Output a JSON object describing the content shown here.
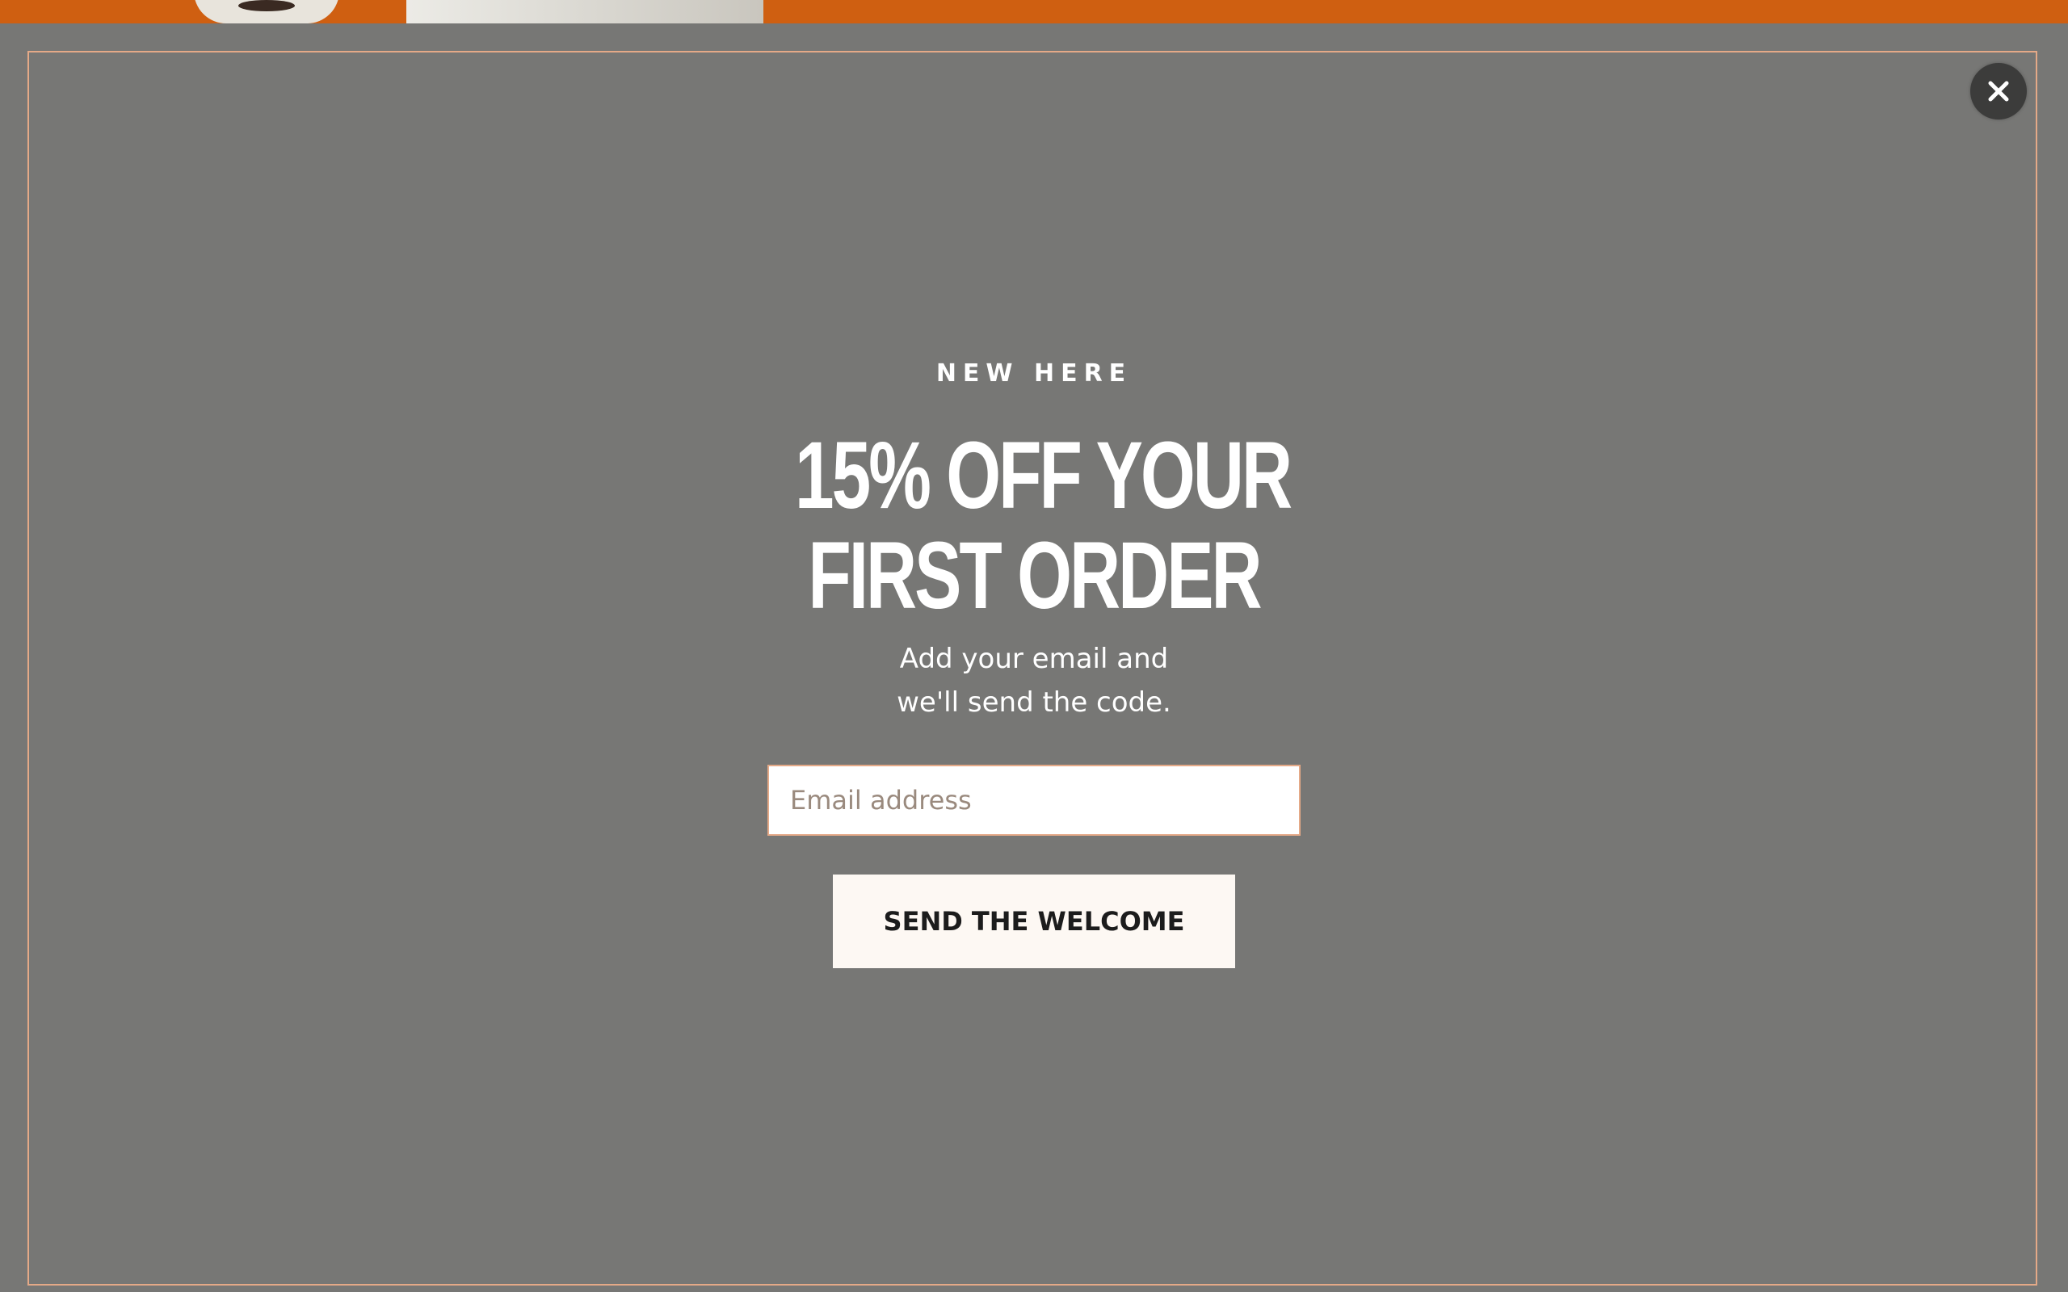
{
  "popup": {
    "eyebrow": "NEW HERE",
    "headline_line1": "15% OFF YOUR",
    "headline_line2": "FIRST ORDER",
    "subtext_line1": "Add your email and",
    "subtext_line2": "we'll send the code.",
    "email_placeholder": "Email address",
    "submit_label": "SEND THE WELCOME",
    "close_icon": "close-icon"
  },
  "colors": {
    "overlay": "#777775",
    "brand_orange": "#cf5f11",
    "frame_border": "#e4a987",
    "button_bg": "#fdf8f3",
    "close_bg": "#3c3c3b"
  }
}
